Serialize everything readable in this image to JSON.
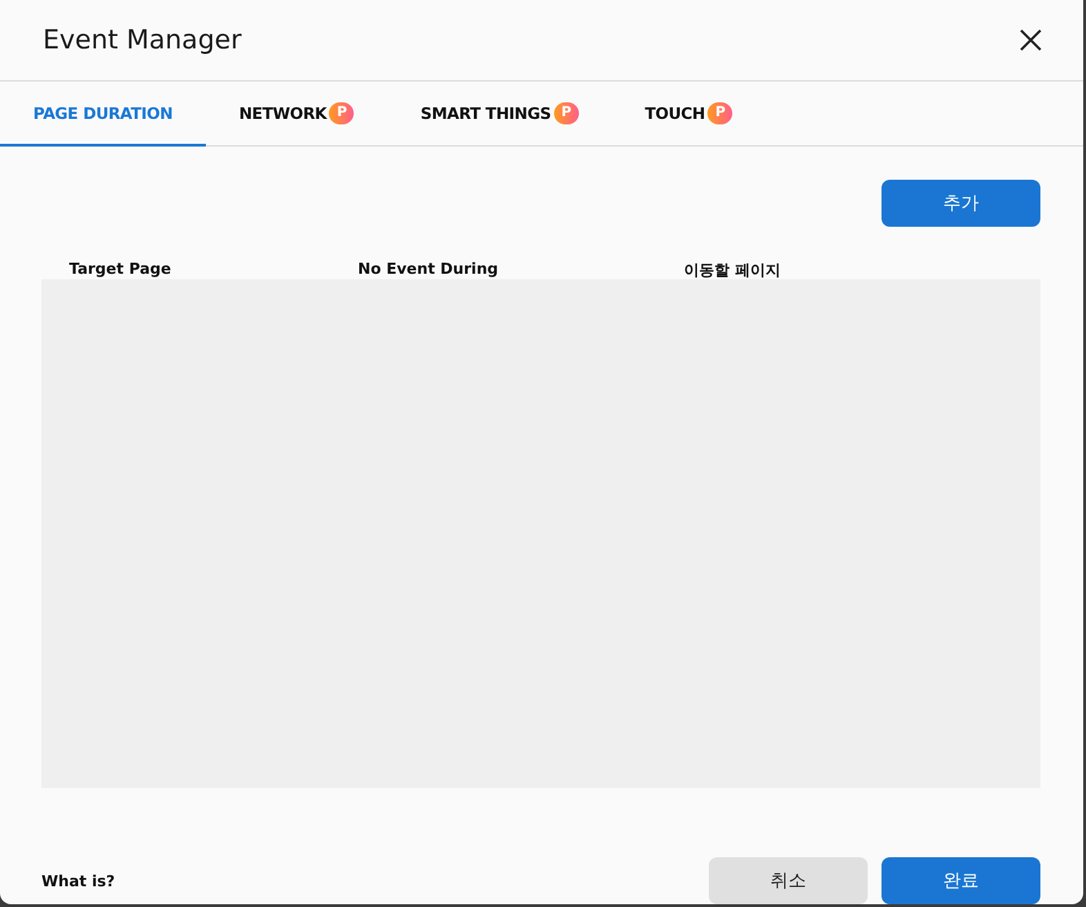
{
  "window": {
    "title": "Event Manager"
  },
  "tabs": [
    {
      "label": "PAGE DURATION",
      "selected": true
    },
    {
      "label": "NETWORK",
      "selected": false,
      "badge": "P"
    },
    {
      "label": "SMART THINGS",
      "selected": false,
      "badge": "P"
    },
    {
      "label": "TOUCH",
      "selected": false,
      "badge": "P"
    }
  ],
  "add_button": "추가",
  "table": {
    "columns": [
      "Target Page",
      "No Event During",
      "이동할 페이지"
    ]
  },
  "footer": {
    "help_link": "What is?",
    "buttons": [
      {
        "label": "취소",
        "kind": "secondary"
      },
      {
        "label": "완료",
        "kind": "primary"
      }
    ]
  }
}
